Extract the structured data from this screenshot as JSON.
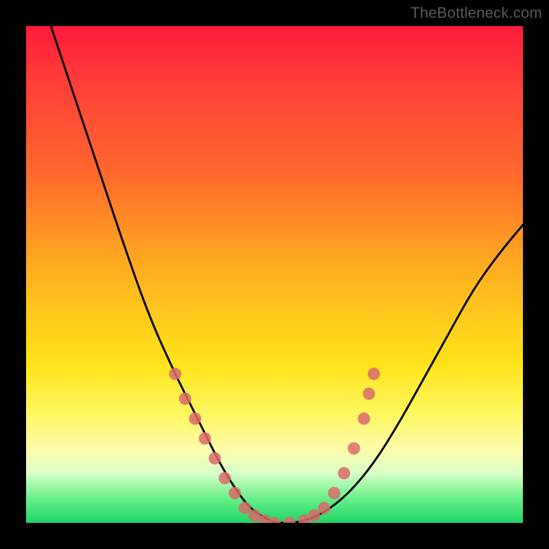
{
  "watermark": "TheBottleneck.com",
  "chart_data": {
    "type": "line",
    "title": "",
    "xlabel": "",
    "ylabel": "",
    "xlim": [
      0,
      100
    ],
    "ylim": [
      0,
      100
    ],
    "grid": false,
    "series": [
      {
        "name": "bottleneck-curve",
        "x": [
          5,
          10,
          15,
          20,
          25,
          30,
          33,
          36,
          39,
          42,
          45,
          48,
          50,
          55,
          60,
          65,
          70,
          75,
          80,
          85,
          90,
          95,
          100
        ],
        "y": [
          100,
          85,
          70,
          55,
          41,
          30,
          24,
          18,
          12,
          7,
          3,
          1,
          0,
          0,
          2,
          6,
          12,
          20,
          29,
          38,
          47,
          54,
          60
        ]
      }
    ],
    "markers": {
      "name": "highlight-dots",
      "points": [
        {
          "x": 30,
          "y": 30
        },
        {
          "x": 32,
          "y": 25
        },
        {
          "x": 34,
          "y": 21
        },
        {
          "x": 36,
          "y": 17
        },
        {
          "x": 38,
          "y": 13
        },
        {
          "x": 40,
          "y": 9
        },
        {
          "x": 42,
          "y": 6
        },
        {
          "x": 44,
          "y": 3
        },
        {
          "x": 46,
          "y": 1.5
        },
        {
          "x": 48,
          "y": 0.5
        },
        {
          "x": 50,
          "y": 0
        },
        {
          "x": 53,
          "y": 0
        },
        {
          "x": 56,
          "y": 0.5
        },
        {
          "x": 58,
          "y": 1.5
        },
        {
          "x": 60,
          "y": 3
        },
        {
          "x": 62,
          "y": 6
        },
        {
          "x": 64,
          "y": 10
        },
        {
          "x": 66,
          "y": 15
        },
        {
          "x": 68,
          "y": 21
        },
        {
          "x": 69,
          "y": 26
        },
        {
          "x": 70,
          "y": 30
        }
      ]
    },
    "background_gradient": {
      "top": "#ff1a3a",
      "mid": "#ffe31a",
      "bottom": "#1fd369"
    },
    "frame_color": "#000000"
  }
}
